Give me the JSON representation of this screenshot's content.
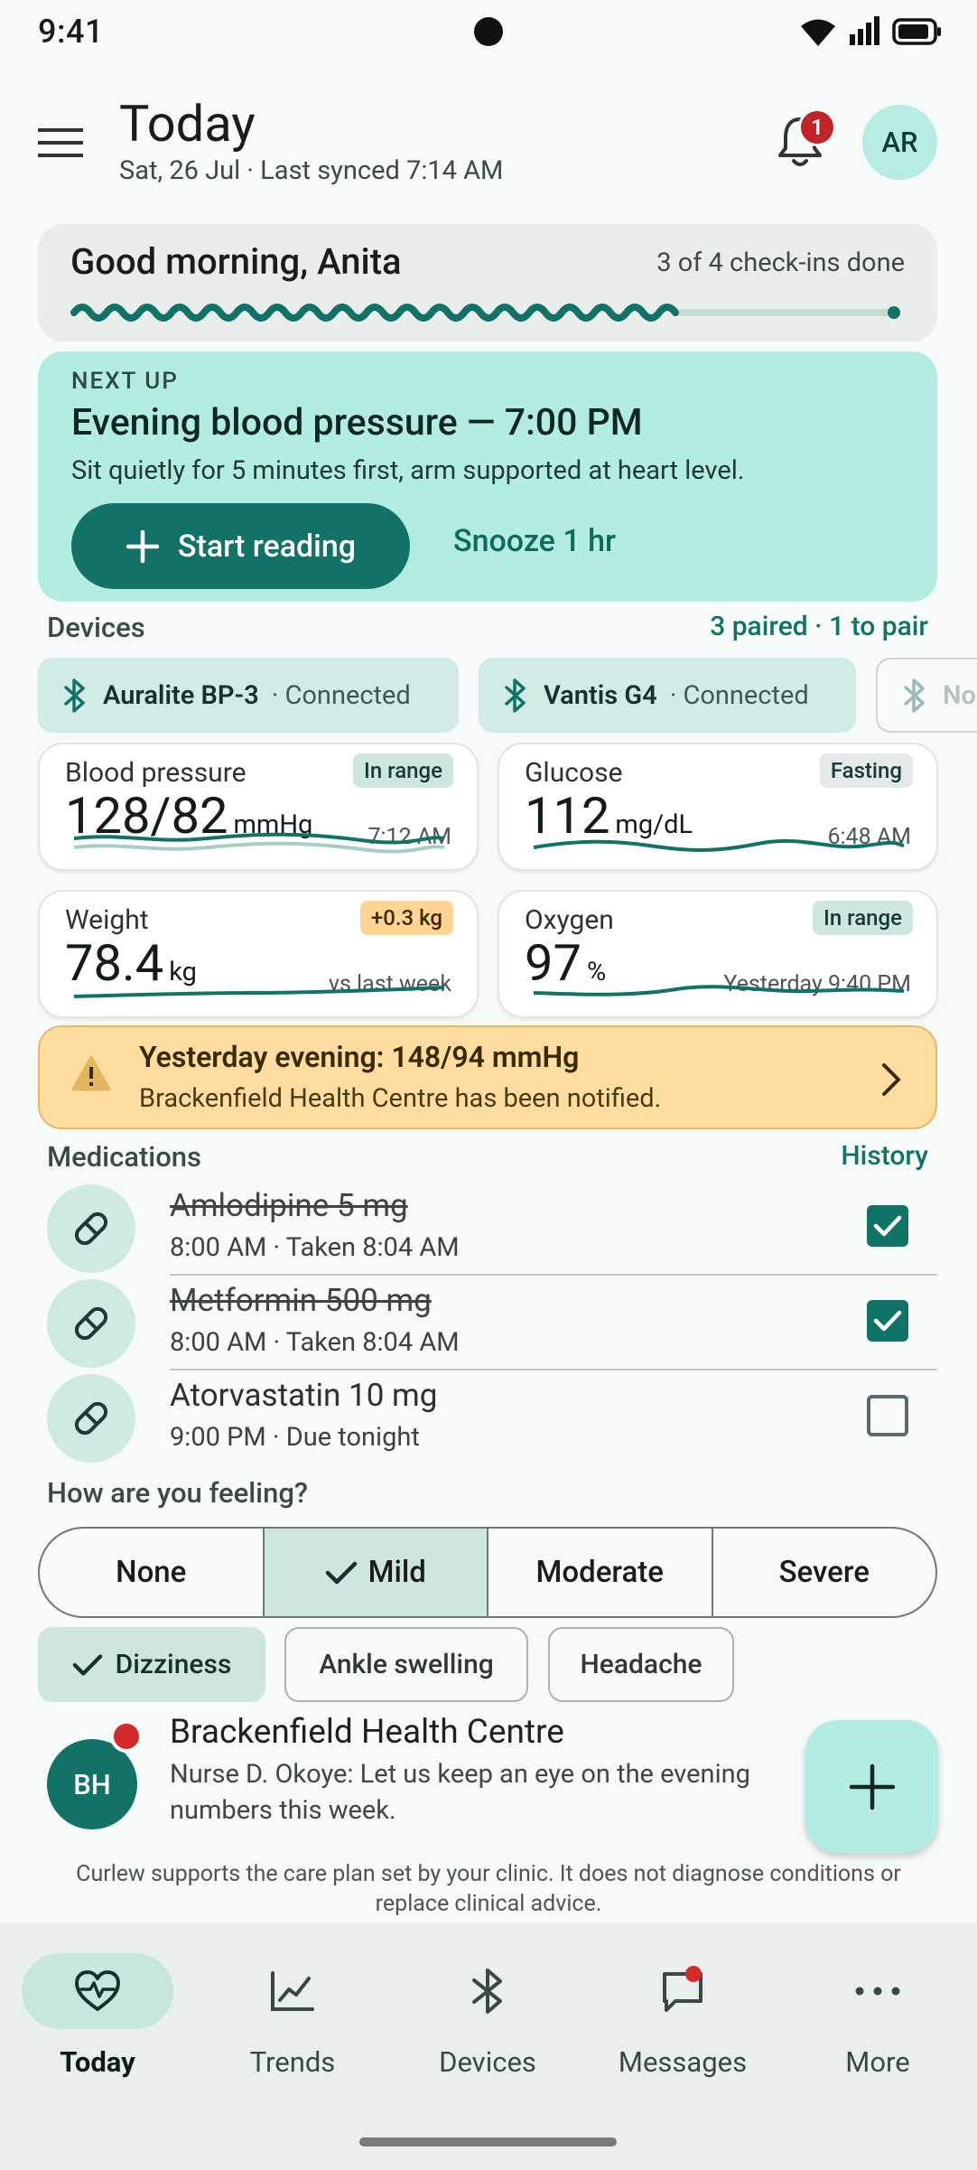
{
  "status_bar": {
    "time": "9:41"
  },
  "header": {
    "title": "Today",
    "subtitle": "Sat, 26 Jul · Last synced 7:14 AM",
    "notification_count": "1",
    "avatar_initials": "AR"
  },
  "greeting": {
    "title": "Good morning, Anita",
    "progress_text": "3 of 4 check-ins done",
    "progress": 0.75
  },
  "next_up": {
    "label": "NEXT UP",
    "title": "Evening blood pressure — 7:00 PM",
    "description": "Sit quietly for 5 minutes first, arm supported at heart level.",
    "start_label": "Start reading",
    "snooze_label": "Snooze 1 hr"
  },
  "devices": {
    "label": "Devices",
    "summary": "3 paired · 1 to pair",
    "items": [
      {
        "name": "Auralite BP-3",
        "status": "· Connected"
      },
      {
        "name": "Vantis G4",
        "status": "· Connected"
      },
      {
        "name": "No",
        "status": ""
      }
    ]
  },
  "metrics": [
    {
      "title": "Blood pressure",
      "value": "128/82",
      "unit": "mmHg",
      "tag": "In range",
      "time": "7:12 AM"
    },
    {
      "title": "Glucose",
      "value": "112",
      "unit": "mg/dL",
      "tag": "Fasting",
      "time": "6:48 AM"
    },
    {
      "title": "Weight",
      "value": "78.4",
      "unit": "kg",
      "tag": "+0.3 kg",
      "time": "vs last week"
    },
    {
      "title": "Oxygen",
      "value": "97",
      "unit": "%",
      "tag": "In range",
      "time": "Yesterday 9:40 PM"
    }
  ],
  "alert": {
    "title": "Yesterday evening: 148/94 mmHg",
    "description": "Brackenfield Health Centre has been notified."
  },
  "medications": {
    "label": "Medications",
    "history_label": "History",
    "items": [
      {
        "name": "Amlodipine 5 mg",
        "detail": "8:00 AM · Taken 8:04 AM",
        "taken": true
      },
      {
        "name": "Metformin 500 mg",
        "detail": "8:00 AM · Taken 8:04 AM",
        "taken": true
      },
      {
        "name": "Atorvastatin 10 mg",
        "detail": "9:00 PM · Due tonight",
        "taken": false
      }
    ]
  },
  "feeling": {
    "label": "How are you feeling?",
    "options": [
      "None",
      "Mild",
      "Moderate",
      "Severe"
    ],
    "selected": "Mild",
    "symptoms": [
      {
        "label": "Dizziness",
        "selected": true
      },
      {
        "label": "Ankle swelling",
        "selected": false
      },
      {
        "label": "Headache",
        "selected": false
      }
    ]
  },
  "message": {
    "initials": "BH",
    "sender": "Brackenfield Health Centre",
    "text": "Nurse D. Okoye: Let us keep an eye on the evening numbers this week."
  },
  "disclaimer": "Curlew supports the care plan set by your clinic. It does not diagnose conditions or replace clinical advice.",
  "nav": {
    "items": [
      "Today",
      "Trends",
      "Devices",
      "Messages",
      "More"
    ],
    "active": "Today"
  },
  "colors": {
    "primary": "#117265",
    "container": "#b3ede1",
    "warning": "#ffdda1",
    "error": "#c3242a"
  }
}
